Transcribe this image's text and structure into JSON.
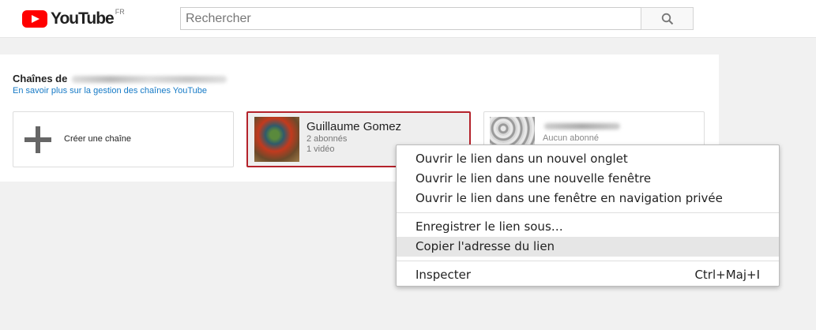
{
  "header": {
    "logo_text": "YouTube",
    "region": "FR",
    "search_placeholder": "Rechercher",
    "search_icon": "magnifier-icon"
  },
  "panel": {
    "title": "Chaînes de",
    "manage_link": "En savoir plus sur la gestion des chaînes YouTube"
  },
  "tiles": {
    "create_label": "Créer une chaîne",
    "channel": {
      "name": "Guillaume Gomez",
      "subscribers": "2 abonnés",
      "videos": "1 vidéo"
    },
    "channel2": {
      "subscribers": "Aucun abonné"
    }
  },
  "context_menu": {
    "items": [
      {
        "label": "Ouvrir le lien dans un nouvel onglet",
        "shortcut": ""
      },
      {
        "label": "Ouvrir le lien dans une nouvelle fenêtre",
        "shortcut": ""
      },
      {
        "label": "Ouvrir le lien dans une fenêtre en navigation privée",
        "shortcut": ""
      },
      {
        "label": "Enregistrer le lien sous…",
        "shortcut": ""
      },
      {
        "label": "Copier l'adresse du lien",
        "shortcut": ""
      },
      {
        "label": "Inspecter",
        "shortcut": "Ctrl+Maj+I"
      }
    ]
  },
  "colors": {
    "brand_red": "#ff0000",
    "link_blue": "#167ac6",
    "selected_border": "#b4222b"
  }
}
